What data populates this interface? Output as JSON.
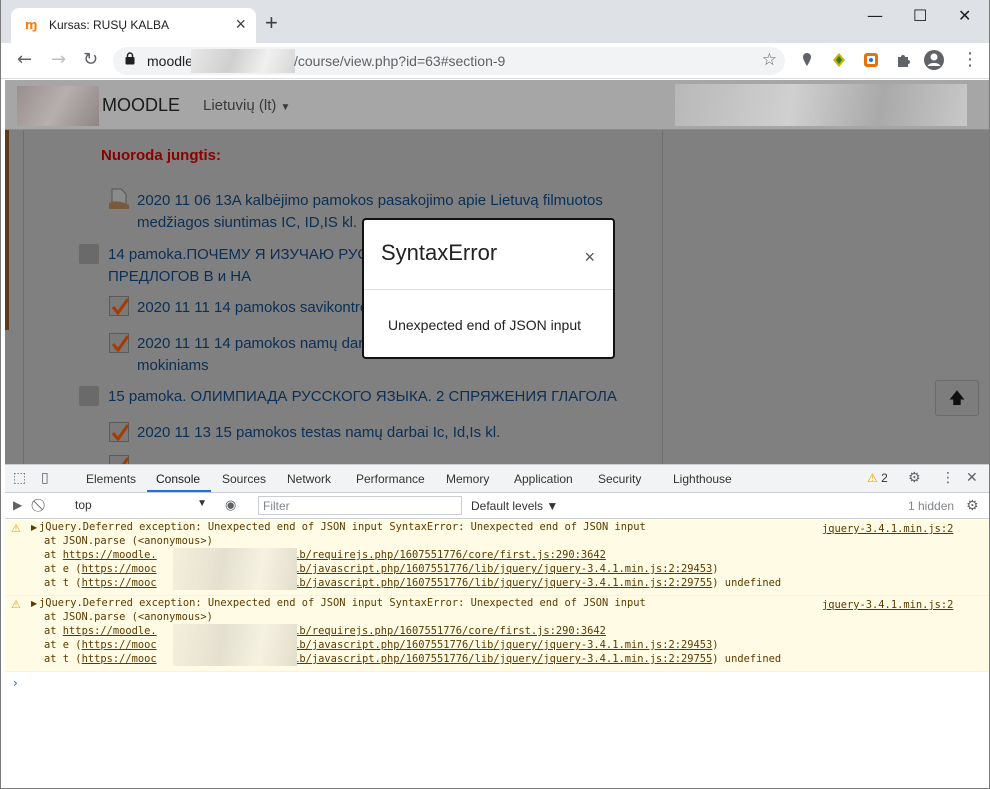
{
  "browser": {
    "tab_title": "Kursas: RUSŲ KALBA",
    "favicon": "moodle-favicon",
    "new_tab_icon": "+",
    "url_host_prefix": "moodle",
    "url_path": "/course/view.php?id=63#section-9"
  },
  "page": {
    "brand": "MOODLE",
    "language": "Lietuvių (lt)",
    "section_heading": "Nuoroda jungtis:",
    "items": [
      {
        "type": "file",
        "line1": "2020 11 06 13A kalbėjimo pamokos pasakojimo apie Lietuvą filmuotos",
        "line2": "medžiagos siuntimas IC, ID,IS kl."
      },
      {
        "type": "book",
        "line1": "14 pamoka.ПОЧЕМУ Я ИЗУЧАЮ РУСС",
        "line2": "ПРЕДЛОГОВ В и НА"
      },
      {
        "type": "assign",
        "line1": "2020 11 11 14 pamokos savikontro",
        "line2": ""
      },
      {
        "type": "assign",
        "line1": "2020 11 11 14 pamokos namų dar",
        "line2": "mokiniams"
      },
      {
        "type": "book",
        "line1": "15 pamoka. ОЛИМПИАДА РУССКОГО ЯЗЫКА. 2 СПРЯЖЕНИЯ ГЛАГОЛА",
        "line2": ""
      },
      {
        "type": "assign",
        "line1": "2020 11 13 15 pamokos testas namų darbai Ic, Id,Is kl.",
        "line2": ""
      }
    ]
  },
  "modal": {
    "title": "SyntaxError",
    "close": "×",
    "message": "Unexpected end of JSON input"
  },
  "devtools": {
    "tabs": [
      "Elements",
      "Console",
      "Sources",
      "Network",
      "Performance",
      "Memory",
      "Application",
      "Security",
      "Lighthouse"
    ],
    "active_tab": "Console",
    "warning_count": "2",
    "context": "top",
    "filter_placeholder": "Filter",
    "levels": "Default levels ▼",
    "hidden": "1 hidden",
    "logs": [
      {
        "message": "jQuery.Deferred exception: Unexpected end of JSON input SyntaxError: Unexpected end of JSON input",
        "source": "jquery-3.4.1.min.js:2",
        "stack1": "    at JSON.parse (<anonymous>)",
        "stack2_prefix": "    at ",
        "stack2_link": "https://moodle.",
        "stack2_rest": "/lib/requirejs.php/1607551776/core/first.js:290:3642",
        "stack3_prefix": "    at e (",
        "stack3_link": "https://mooc",
        "stack3_rest": "/lib/javascript.php/1607551776/lib/jquery/jquery-3.4.1.min.js:2:29453",
        "stack3_suffix": ")",
        "stack4_prefix": "    at t (",
        "stack4_link": "https://mooc",
        "stack4_rest": "/lib/javascript.php/1607551776/lib/jquery/jquery-3.4.1.min.js:2:29755",
        "stack4_suffix": ") undefined"
      },
      {
        "message": "jQuery.Deferred exception: Unexpected end of JSON input SyntaxError: Unexpected end of JSON input",
        "source": "jquery-3.4.1.min.js:2",
        "stack1": "    at JSON.parse (<anonymous>)",
        "stack2_prefix": "    at ",
        "stack2_link": "https://moodle.",
        "stack2_rest": "/lib/requirejs.php/1607551776/core/first.js:290:3642",
        "stack3_prefix": "    at e (",
        "stack3_link": "https://mooc",
        "stack3_rest": "/lib/javascript.php/1607551776/lib/jquery/jquery-3.4.1.min.js:2:29453",
        "stack3_suffix": ")",
        "stack4_prefix": "    at t (",
        "stack4_link": "https://mooc",
        "stack4_rest": "/lib/javascript.php/1607551776/lib/jquery/jquery-3.4.1.min.js:2:29755",
        "stack4_suffix": ") undefined"
      }
    ],
    "prompt": "›"
  },
  "colors": {
    "overlay_gray": "#808080",
    "link_dark": "#0b2f55",
    "heading_red": "#8b0000",
    "warn_bg": "#fffbe5",
    "accent_blue": "#1a73e8"
  }
}
